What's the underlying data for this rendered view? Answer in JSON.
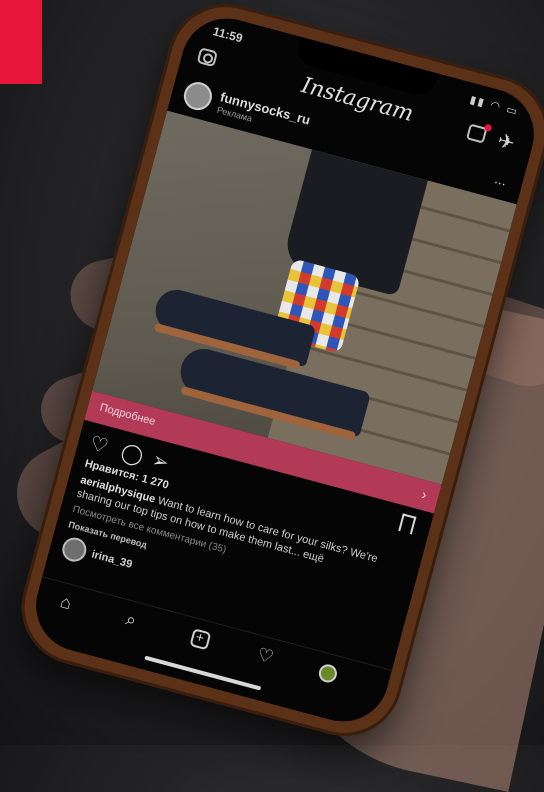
{
  "colors": {
    "accent_red": "#e8173a",
    "cta_bar": "#b33a57",
    "phone_case": "#5b3217"
  },
  "status": {
    "time": "11:59",
    "icons": "▮▮ ◠ ▭"
  },
  "header": {
    "logo": "Instagram"
  },
  "post": {
    "username": "funnysocks_ru",
    "sponsored": "Реклама",
    "more": "...",
    "cta_label": "Подробнее",
    "cta_arrow": "›",
    "likes": "Нравится: 1 270",
    "caption_user": "aerialphysique",
    "caption_text": "Want to learn how to care for your silks? We're sharing our top tips on how to make them last... ещё",
    "view_comments": "Посмотреть все комментарии (35)",
    "translate": "Показать перевод",
    "commenter": "irina_39"
  },
  "icons": {
    "camera": "camera-icon",
    "igtv": "igtv-icon",
    "direct": "paper-plane-icon",
    "like": "heart-icon",
    "comment": "comment-icon",
    "share": "share-icon",
    "save": "bookmark-icon",
    "home": "home-icon",
    "search": "search-icon",
    "add": "add-post-icon",
    "activity": "heart-icon",
    "profile": "profile-icon"
  }
}
